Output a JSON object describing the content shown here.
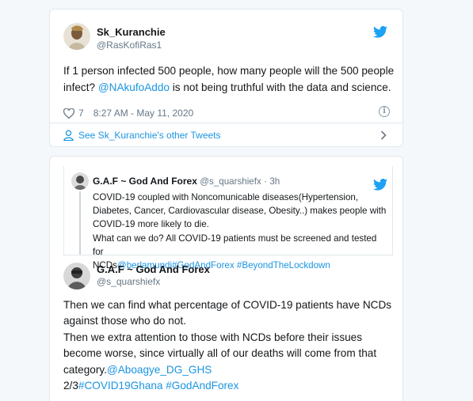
{
  "tweet1": {
    "name": "Sk_Kuranchie",
    "handle": "@RasKofiRas1",
    "text_before": "If 1 person infected 500 people, how many people will the 500 people infect? ",
    "mention": "@NAkufoAddo",
    "text_after": " is not being truthful with the data and science.",
    "like_count": "7",
    "timestamp": "8:27 AM - May 11, 2020",
    "see_more": "See Sk_Kuranchie's other Tweets"
  },
  "tweet2": {
    "quote": {
      "name": "G.A.F ~ God And Forex",
      "handle": "@s_quarshiefx",
      "time": "3h",
      "line1": "COVID-19 coupled with Noncomunicable diseases(Hypertension,",
      "line2": "Diabetes, Cancer, Cardiovascular disease, Obesity..) makes people with",
      "line3": "COVID-19 more likely to die.",
      "line4": "What can we do? All COVID-19 patients must be screened and tested for",
      "line5_text": "NCDs",
      "line5_links": "@berlamundi#GodAndForex #BeyondTheLockdown"
    },
    "name": "G.A.F ~ God And Forex",
    "handle": "@s_quarshiefx",
    "line1": "Then we can find what percentage of COVID-19 patients have NCDs",
    "line2": "against those who do not.",
    "line3": "Then we extra attention to those with NCDs before their issues",
    "line4": "become worse, since virtually all of our deaths will come from that",
    "line5_text": "category.",
    "line5_link": "@Aboagye_DG_GHS",
    "line6_text": "2/3",
    "line6_links": "#COVID19Ghana #GodAndForex"
  },
  "colors": {
    "link": "#1b95e0",
    "muted": "#657786",
    "border": "#e1e8ed",
    "background": "#f5f8fa"
  }
}
